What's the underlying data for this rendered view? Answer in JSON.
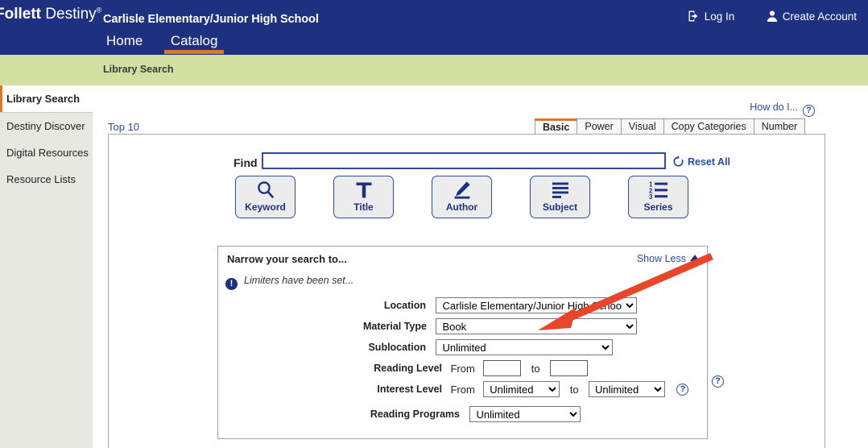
{
  "header": {
    "logo_bold": "Follett",
    "logo_light": "Destiny",
    "logo_reg": "®",
    "school_name": "Carlisle Elementary/Junior High School",
    "nav": [
      {
        "label": "Home",
        "active": false
      },
      {
        "label": "Catalog",
        "active": true
      }
    ],
    "login_label": "Log In",
    "login_icon": "sign-in-icon",
    "create_account_label": "Create Account",
    "create_account_icon": "person-icon",
    "bg_color": "#1e3180",
    "accent_color": "#d9772b"
  },
  "breadcrumb": {
    "label": "Library Search",
    "bg_color": "#d4dfa2"
  },
  "sidebar": {
    "items": [
      {
        "label": "Library Search",
        "active": true
      },
      {
        "label": "Destiny Discover",
        "active": false
      },
      {
        "label": "Digital Resources",
        "active": false
      },
      {
        "label": "Resource Lists",
        "active": false
      }
    ]
  },
  "content": {
    "how_do_i": "How do I...",
    "how_do_i_icon": "help-icon",
    "top10": "Top 10",
    "tabs": [
      {
        "label": "Basic",
        "active": true
      },
      {
        "label": "Power",
        "active": false
      },
      {
        "label": "Visual",
        "active": false
      },
      {
        "label": "Copy Categories",
        "active": false
      },
      {
        "label": "Number",
        "active": false
      }
    ],
    "find": {
      "label": "Find",
      "value": "",
      "placeholder": ""
    },
    "reset_all": {
      "label": "Reset All",
      "icon": "refresh-icon"
    },
    "search_types": [
      {
        "label": "Keyword",
        "icon": "magnifier-icon"
      },
      {
        "label": "Title",
        "icon": "letter-t-icon"
      },
      {
        "label": "Author",
        "icon": "pencil-icon"
      },
      {
        "label": "Subject",
        "icon": "lines-icon"
      },
      {
        "label": "Series",
        "icon": "numbered-list-icon"
      }
    ],
    "narrow": {
      "title": "Narrow your search to...",
      "show_less": "Show Less",
      "show_less_icon": "caret-up-icon",
      "limiters_notice": "Limiters have been set...",
      "limiters_icon": "info-icon",
      "fields": {
        "location": {
          "label": "Location",
          "value": "Carlisle Elementary/Junior High School",
          "options": [
            "Carlisle Elementary/Junior High School"
          ]
        },
        "material_type": {
          "label": "Material Type",
          "value": "Book",
          "options": [
            "Book"
          ]
        },
        "sublocation": {
          "label": "Sublocation",
          "value": "Unlimited",
          "options": [
            "Unlimited"
          ]
        },
        "reading_level": {
          "label": "Reading Level",
          "from_label": "From",
          "to_label": "to",
          "from_value": "",
          "to_value": ""
        },
        "interest_level": {
          "label": "Interest Level",
          "from_label": "From",
          "to_label": "to",
          "from_value": "Unlimited",
          "to_value": "Unlimited",
          "options": [
            "Unlimited"
          ],
          "help_icon": "help-icon"
        },
        "reading_programs": {
          "label": "Reading Programs",
          "value": "Unlimited",
          "options": [
            "Unlimited"
          ],
          "help_icon": "help-icon"
        }
      }
    }
  },
  "annotation": {
    "arrow_color": "#e8462a",
    "points_at": "material-type-select"
  }
}
